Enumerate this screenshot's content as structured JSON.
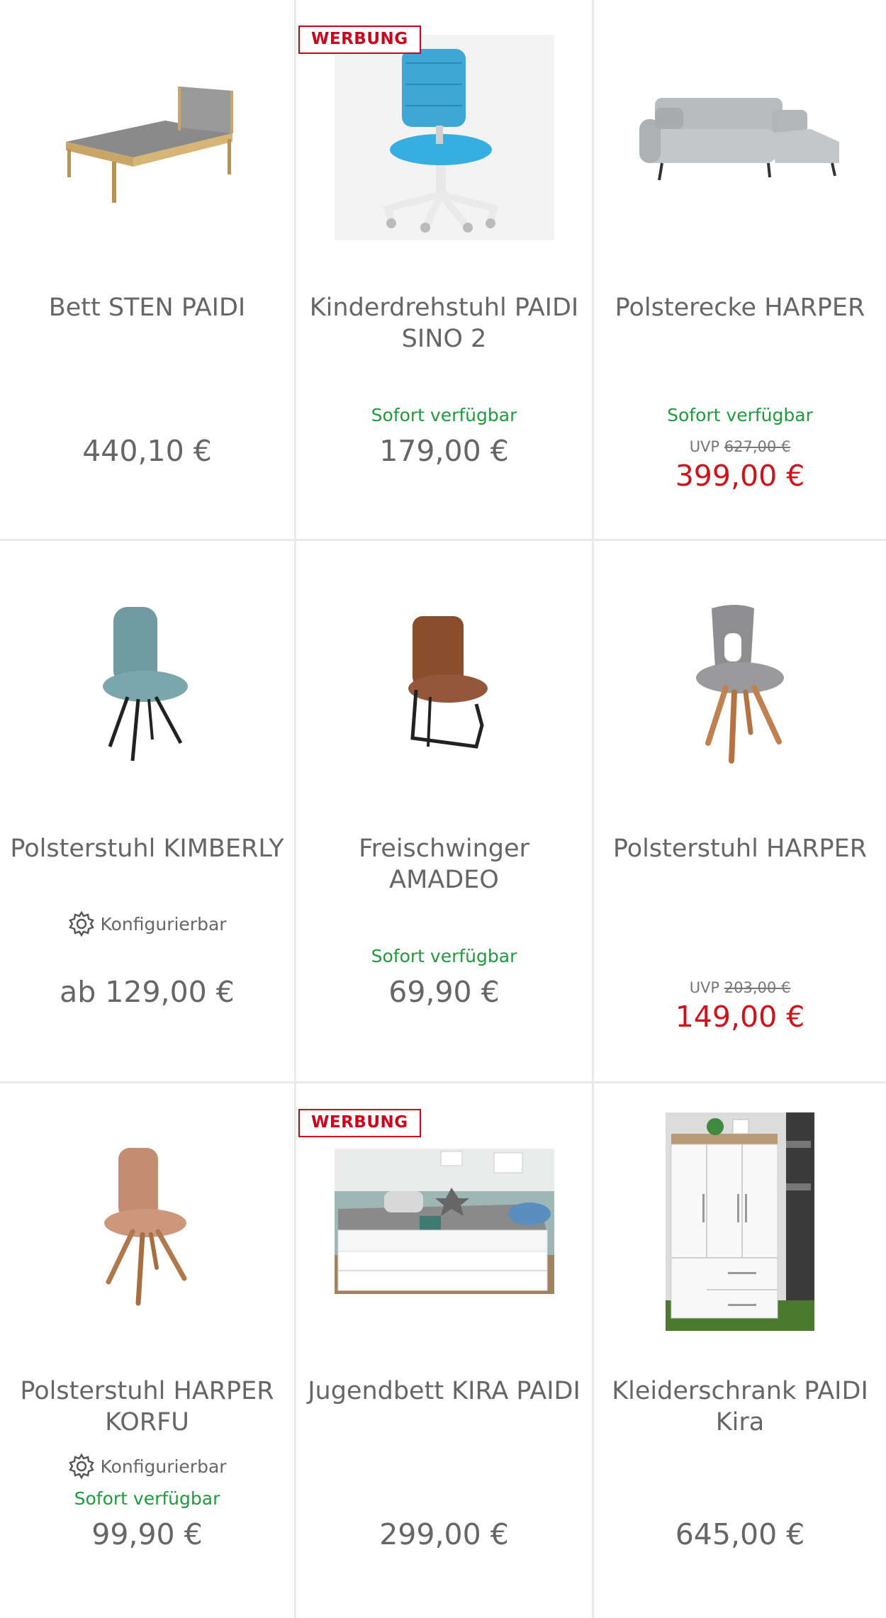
{
  "products": [
    {
      "title": "Bett STEN PAIDI",
      "price": "440,10 €",
      "image_icon": "bed-icon"
    },
    {
      "title": "Kinderdrehstuhl PAIDI SINO 2",
      "ad_label": "WERBUNG",
      "availability": "Sofort verfügbar",
      "price": "179,00 €",
      "image_icon": "childrens-swivel-chair-icon"
    },
    {
      "title": "Polsterecke HARPER",
      "availability": "Sofort verfügbar",
      "uvp_label": "UVP",
      "uvp_price": "627,00 €",
      "price": "399,00 €",
      "image_icon": "corner-sofa-icon"
    },
    {
      "title": "Polsterstuhl KIMBERLY",
      "configurable": "Konfigurierbar",
      "price": "ab 129,00 €",
      "image_icon": "chair-icon"
    },
    {
      "title": "Freischwinger AMADEO",
      "availability": "Sofort verfügbar",
      "price": "69,90 €",
      "image_icon": "cantilever-chair-icon"
    },
    {
      "title": "Polsterstuhl HARPER",
      "uvp_label": "UVP",
      "uvp_price": "203,00 €",
      "price": "149,00 €",
      "image_icon": "chair-icon"
    },
    {
      "title": "Polsterstuhl HARPER KORFU",
      "configurable": "Konfigurierbar",
      "availability": "Sofort verfügbar",
      "price": "99,90 €",
      "image_icon": "chair-icon"
    },
    {
      "title": "Jugendbett KIRA PAIDI",
      "ad_label": "WERBUNG",
      "price": "299,00 €",
      "image_icon": "youth-bed-icon"
    },
    {
      "title": "Kleiderschrank PAIDI Kira",
      "price": "645,00 €",
      "image_icon": "wardrobe-icon"
    }
  ],
  "colors": {
    "availability": "#1f9a3d",
    "sale_price": "#d0121b",
    "ad_badge": "#d0021b",
    "divider": "#e9e9e9"
  }
}
